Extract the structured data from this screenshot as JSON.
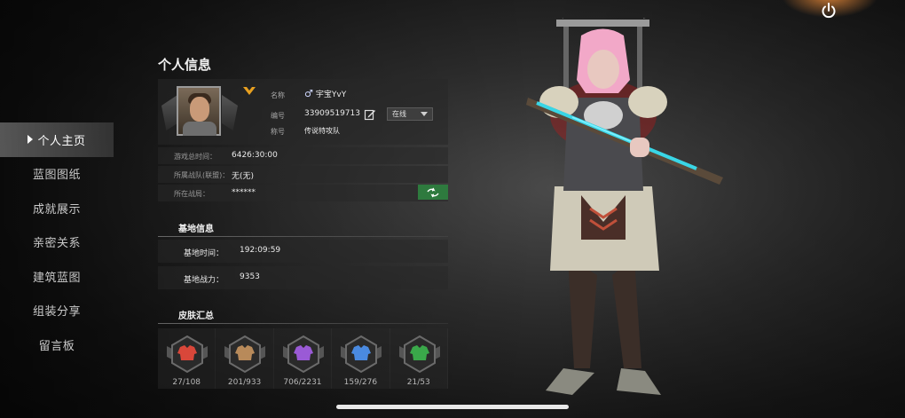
{
  "sidebar": {
    "items": [
      {
        "label": "个人主页",
        "active": true
      },
      {
        "label": "蓝图图纸",
        "active": false
      },
      {
        "label": "成就展示",
        "active": false
      },
      {
        "label": "亲密关系",
        "active": false
      },
      {
        "label": "建筑蓝图",
        "active": false
      },
      {
        "label": "组装分享",
        "active": false
      },
      {
        "label": "留言板",
        "active": false
      }
    ]
  },
  "panel": {
    "title": "个人信息",
    "profile": {
      "name_label": "名称",
      "gender": "♂",
      "name": "宇宝YvY",
      "id_label": "编号",
      "id": "33909519713",
      "title_label": "称号",
      "title_value": "传说特攻队",
      "status": "在线"
    },
    "rows": [
      {
        "label": "游戏总时间：",
        "value": "6426:30:00"
      },
      {
        "label": "所属战队(联盟)：",
        "value": "无(无)"
      },
      {
        "label": "所在战局：",
        "value": "******"
      }
    ],
    "base": {
      "heading": "基地信息",
      "time_label": "基地时间：",
      "time_value": "192:09:59",
      "power_label": "基地战力：",
      "power_value": "9353"
    },
    "skins": {
      "heading": "皮肤汇总",
      "items": [
        {
          "count": "27/108",
          "color": "#d9473a"
        },
        {
          "count": "201/933",
          "color": "#b88a5a"
        },
        {
          "count": "706/2231",
          "color": "#9a5ad6"
        },
        {
          "count": "159/276",
          "color": "#4a8ae0"
        },
        {
          "count": "21/53",
          "color": "#3aa84a"
        }
      ]
    }
  },
  "colors": {
    "accent_green": "#2e7a3e",
    "vip_gold": "#e8a020"
  },
  "icons": {
    "power": "power-icon",
    "edit": "edit-icon",
    "switch": "switch-icon"
  }
}
